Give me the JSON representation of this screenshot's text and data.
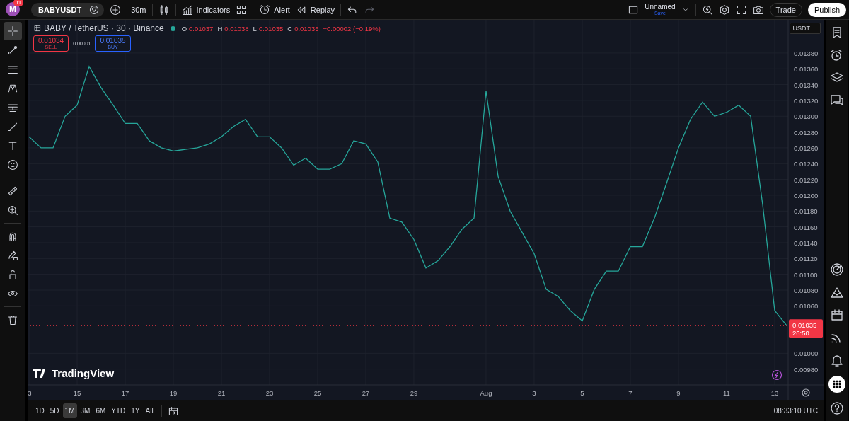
{
  "top_bar": {
    "avatar": "M",
    "notification_count": "11",
    "symbol": "BABYUSDT",
    "interval": "30m",
    "indicators": "Indicators",
    "alert": "Alert",
    "replay": "Replay",
    "layout_name": "Unnamed",
    "save_label": "Save",
    "trade": "Trade",
    "publish": "Publish"
  },
  "tool_groups": [
    {
      "tools": [
        {
          "kind": "crosshair",
          "selected": true
        },
        {
          "kind": "line",
          "selected": false
        },
        {
          "kind": "lines",
          "selected": false
        },
        {
          "kind": "zigzag",
          "selected": false
        },
        {
          "kind": "sliders",
          "selected": false
        },
        {
          "kind": "brush",
          "selected": false
        },
        {
          "kind": "text",
          "selected": false
        },
        {
          "kind": "smiley",
          "selected": false
        }
      ]
    },
    {
      "tools": [
        {
          "kind": "ruler",
          "selected": false
        },
        {
          "kind": "zoom-in",
          "selected": false
        }
      ]
    },
    {
      "tools": [
        {
          "kind": "magnet",
          "selected": false
        },
        {
          "kind": "pencil-lock",
          "selected": false
        },
        {
          "kind": "lock",
          "selected": false
        },
        {
          "kind": "eye",
          "selected": false
        }
      ]
    },
    {
      "tools": [
        {
          "kind": "trash",
          "selected": false
        }
      ]
    }
  ],
  "legend": {
    "title": "BABY / TetherUS · 30 · Binance",
    "values": [
      {
        "label": "O",
        "value": "0.01037"
      },
      {
        "label": "H",
        "value": "0.01038"
      },
      {
        "label": "L",
        "value": "0.01035"
      },
      {
        "label": "C",
        "value": "0.01035"
      }
    ],
    "change": "−0.00002 (−0.19%)"
  },
  "order": {
    "sell_price": "0.01034",
    "sell": "SELL",
    "spread": "0.00001",
    "buy_price": "0.01035",
    "buy": "BUY"
  },
  "currency": "USDT",
  "price_tag": {
    "price": "0.01035",
    "countdown": "26:50"
  },
  "logo_text": "TradingView",
  "chart_data": {
    "type": "line",
    "categories": [
      "3",
      null,
      null,
      null,
      "15",
      null,
      null,
      null,
      "17",
      null,
      null,
      null,
      "19",
      null,
      null,
      null,
      "21",
      null,
      null,
      null,
      "23",
      null,
      null,
      null,
      "25",
      null,
      null,
      null,
      "27",
      null,
      null,
      null,
      "29",
      null,
      null,
      null,
      null,
      null,
      "Aug",
      null,
      null,
      null,
      "3",
      null,
      null,
      null,
      "5",
      null,
      null,
      null,
      "7",
      null,
      null,
      null,
      "9",
      null,
      null,
      null,
      "11",
      null,
      null,
      null,
      "13",
      null
    ],
    "series": [
      {
        "color": "#26a69a",
        "values": [
          0.01274,
          0.0126,
          0.0126,
          0.013,
          0.01314,
          0.01363,
          0.01336,
          0.01314,
          0.01291,
          0.01291,
          0.01269,
          0.0126,
          0.01256,
          0.01258,
          0.0126,
          0.01265,
          0.01274,
          0.01287,
          0.01296,
          0.01274,
          0.01274,
          0.0126,
          0.01238,
          0.01247,
          0.01233,
          0.01233,
          0.0124,
          0.01269,
          0.01265,
          0.01242,
          0.01171,
          0.01166,
          0.01144,
          0.01108,
          0.01117,
          0.01135,
          0.01157,
          0.01171,
          0.01332,
          0.01224,
          0.0118,
          0.01153,
          0.01126,
          0.01081,
          0.01072,
          0.01054,
          0.01041,
          0.01081,
          0.01104,
          0.01104,
          0.01135,
          0.01135,
          0.01171,
          0.01215,
          0.0126,
          0.01296,
          0.01318,
          0.013,
          0.01305,
          0.01314,
          0.013,
          0.01188,
          0.01054,
          0.01035
        ]
      }
    ],
    "ylim": [
      0.0096,
      0.01422
    ],
    "grid": true,
    "ref_lines": [
      {
        "axis": "y",
        "value": 0.01035,
        "color": "#f23645"
      }
    ],
    "yticks": [
      {
        "value": 0.0138,
        "label": "0.01380"
      },
      {
        "value": 0.0136,
        "label": "0.01360"
      },
      {
        "value": 0.0134,
        "label": "0.01340"
      },
      {
        "value": 0.0132,
        "label": "0.01320"
      },
      {
        "value": 0.013,
        "label": "0.01300"
      },
      {
        "value": 0.0128,
        "label": "0.01280"
      },
      {
        "value": 0.0126,
        "label": "0.01260"
      },
      {
        "value": 0.0124,
        "label": "0.01240"
      },
      {
        "value": 0.0122,
        "label": "0.01220"
      },
      {
        "value": 0.012,
        "label": "0.01200"
      },
      {
        "value": 0.0118,
        "label": "0.01180"
      },
      {
        "value": 0.0116,
        "label": "0.01160"
      },
      {
        "value": 0.0114,
        "label": "0.01140"
      },
      {
        "value": 0.0112,
        "label": "0.01120"
      },
      {
        "value": 0.011,
        "label": "0.01100"
      },
      {
        "value": 0.0108,
        "label": "0.01080"
      },
      {
        "value": 0.0106,
        "label": "0.01060"
      },
      {
        "value": 0.01,
        "label": "0.01000"
      },
      {
        "value": 0.0098,
        "label": "0.00980"
      }
    ]
  },
  "range_buttons": [
    {
      "label": "1D",
      "selected": false
    },
    {
      "label": "5D",
      "selected": false
    },
    {
      "label": "1M",
      "selected": true
    },
    {
      "label": "3M",
      "selected": false
    },
    {
      "label": "6M",
      "selected": false
    },
    {
      "label": "YTD",
      "selected": false
    },
    {
      "label": "1Y",
      "selected": false
    },
    {
      "label": "All",
      "selected": false
    }
  ],
  "clock": "08:33:10 UTC"
}
